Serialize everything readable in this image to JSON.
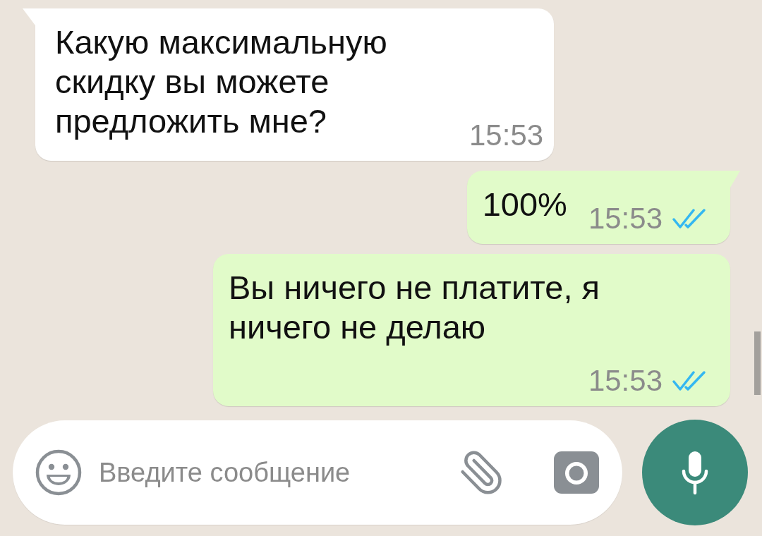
{
  "messages": [
    {
      "kind": "incoming",
      "text": "Какую максимальную скидку вы можете предложить мне?",
      "time": "15:53"
    },
    {
      "kind": "outgoing",
      "text": "100%",
      "time": "15:53",
      "read": true
    },
    {
      "kind": "outgoing",
      "text": "Вы ничего не платите, я ничего не делаю",
      "time": "15:53",
      "read": true
    }
  ],
  "composer": {
    "placeholder": "Введите сообщение"
  }
}
